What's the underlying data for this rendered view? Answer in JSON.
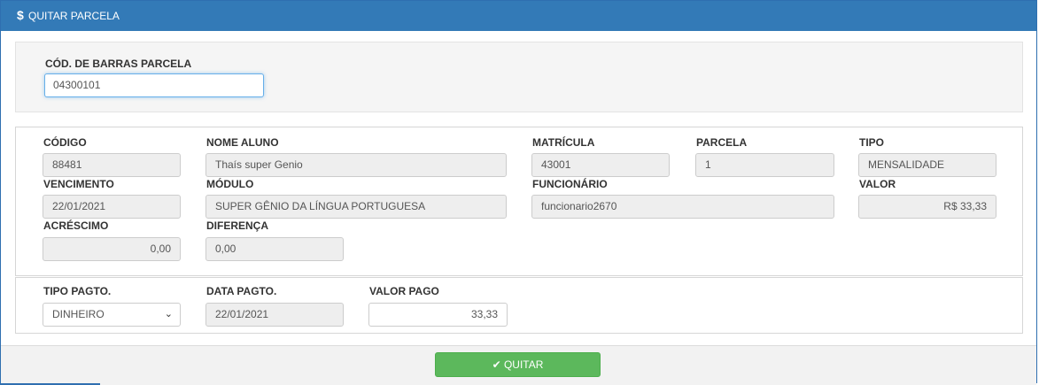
{
  "header": {
    "icon": "dollar-icon",
    "title": "QUITAR PARCELA",
    "color": "#337ab7"
  },
  "barcode": {
    "label": "CÓD. DE BARRAS PARCELA",
    "value": "04300101"
  },
  "details": {
    "codigo": {
      "label": "CÓDIGO",
      "value": "88481"
    },
    "nome_aluno": {
      "label": "NOME ALUNO",
      "value": "Thaís super Genio"
    },
    "matricula": {
      "label": "MATRÍCULA",
      "value": "43001"
    },
    "parcela": {
      "label": "PARCELA",
      "value": "1"
    },
    "tipo": {
      "label": "TIPO",
      "value": "MENSALIDADE"
    },
    "vencimento": {
      "label": "VENCIMENTO",
      "value": "22/01/2021"
    },
    "modulo": {
      "label": "MÓDULO",
      "value": "SUPER GÊNIO DA LÍNGUA PORTUGUESA"
    },
    "funcionario": {
      "label": "FUNCIONÁRIO",
      "value": "funcionario2670"
    },
    "valor": {
      "label": "VALOR",
      "value": "R$ 33,33"
    },
    "acrescimo": {
      "label": "ACRÉSCIMO",
      "value": "0,00"
    },
    "diferenca": {
      "label": "DIFERENÇA",
      "value": "0,00"
    }
  },
  "payment": {
    "tipo_pagto": {
      "label": "TIPO PAGTO.",
      "value": "DINHEIRO"
    },
    "data_pagto": {
      "label": "DATA PAGTO.",
      "value": "22/01/2021"
    },
    "valor_pago": {
      "label": "VALOR PAGO",
      "value": "33,33"
    }
  },
  "footer": {
    "quitar_label": "QUITAR",
    "button_color": "#5cb85c",
    "icon": "check-icon"
  }
}
